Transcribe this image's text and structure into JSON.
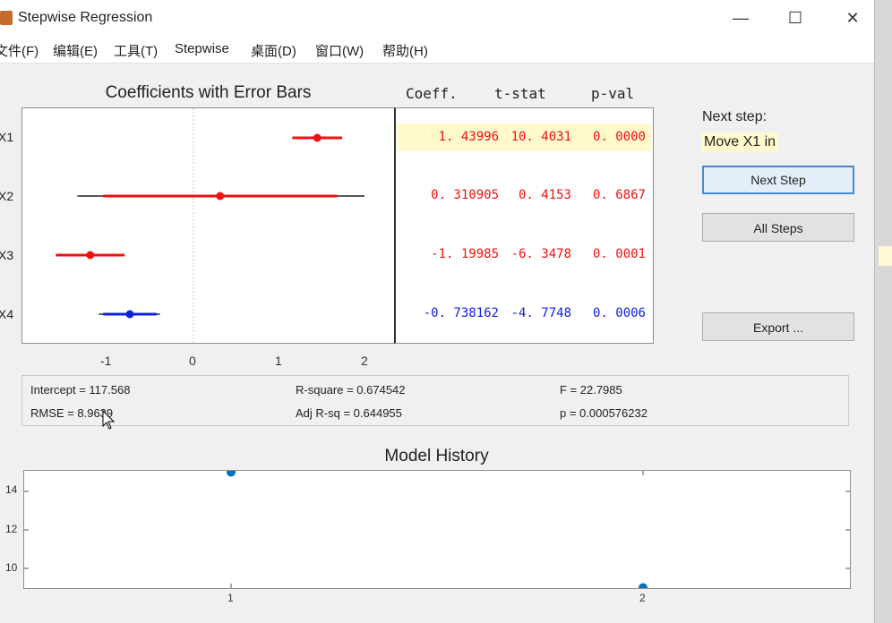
{
  "window": {
    "title": "Stepwise Regression",
    "minimize": "—",
    "maximize": "☐",
    "close": "✕"
  },
  "menu": [
    "文件(F)",
    "编辑(E)",
    "工具(T)",
    "Stepwise",
    "桌面(D)",
    "窗口(W)",
    "帮助(H)"
  ],
  "coef_panel": {
    "title": "Coefficients with Error Bars",
    "x_ticks": [
      "-1",
      "0",
      "1",
      "2"
    ],
    "headers": {
      "coeff": "Coeff.",
      "tstat": "t-stat",
      "pval": "p-val"
    },
    "rows": [
      {
        "label": "X1",
        "coeff": "1. 43996",
        "tstat": "10. 4031",
        "pval": "0. 0000",
        "status": "out",
        "highlight": true
      },
      {
        "label": "X2",
        "coeff": "0. 310905",
        "tstat": "0. 4153",
        "pval": "0. 6867",
        "status": "out",
        "highlight": false
      },
      {
        "label": "X3",
        "coeff": "-1. 19985",
        "tstat": "-6. 3478",
        "pval": "0. 0001",
        "status": "out",
        "highlight": false
      },
      {
        "label": "X4",
        "coeff": "-0. 738162",
        "tstat": "-4. 7748",
        "pval": "0. 0006",
        "status": "in",
        "highlight": false
      }
    ]
  },
  "side": {
    "next_step_label": "Next step:",
    "next_step_value": "Move X1 in",
    "next_step_button": "Next Step",
    "all_steps_button": "All Steps",
    "export_button": "Export ..."
  },
  "stats": {
    "intercept": "Intercept = 117.568",
    "rmse": "RMSE = 8.9639",
    "rsquare": "R-square = 0.674542",
    "adj_rsq": "Adj R-sq = 0.644955",
    "f": "F = 22.7985",
    "p": "p = 0.000576232"
  },
  "colors": {
    "out": "#f01010",
    "in": "#1020e0",
    "history": "#0072bd",
    "highlight": "#fff9cc"
  },
  "chart_data": [
    {
      "type": "scatter",
      "title": "Coefficients with Error Bars",
      "xlim": [
        -2,
        2.35
      ],
      "x_ticks": [
        -1,
        0,
        1,
        2
      ],
      "categories": [
        "X1",
        "X2",
        "X3",
        "X4"
      ],
      "series": [
        {
          "estimates": [
            1.44,
            0.31,
            -1.2,
            -0.74
          ],
          "inner": [
            [
              1.15,
              1.73
            ],
            [
              -1.05,
              1.67
            ],
            [
              -1.6,
              -0.8
            ],
            [
              -1.05,
              -0.43
            ]
          ],
          "outer": [
            [
              1.15,
              1.73
            ],
            [
              -1.35,
              1.99
            ],
            [
              -1.6,
              -0.8
            ],
            [
              -1.1,
              -0.39
            ]
          ]
        }
      ]
    },
    {
      "type": "scatter",
      "title": "Model History",
      "x": [
        1,
        2
      ],
      "y": [
        15.0,
        9.0
      ],
      "x_ticks": [
        1,
        2
      ],
      "y_ticks": [
        10,
        12,
        14
      ],
      "xlim": [
        0.5,
        2.5
      ],
      "ylim": [
        8.9,
        15.5
      ]
    }
  ]
}
